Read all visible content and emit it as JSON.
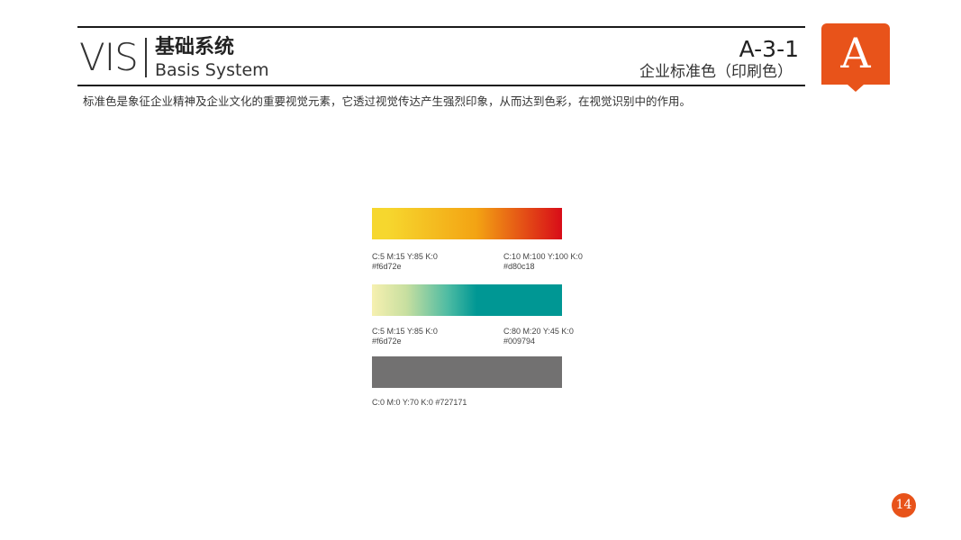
{
  "header": {
    "logo": "VIS",
    "title_cn": "基础系统",
    "title_en": "Basis System",
    "code": "A-3-1",
    "subtitle": "企业标准色（印刷色）"
  },
  "tab": {
    "letter": "A",
    "color": "#e8531a"
  },
  "description": "标准色是象征企业精神及企业文化的重要视觉元素，它透过视觉传达产生强烈印象，从而达到色彩，在视觉识别中的作用。",
  "swatches": [
    {
      "gradient_colors": [
        "#f6d72e",
        "#d80c18"
      ],
      "left_cmyk": "C:5  M:15  Y:85  K:0",
      "left_hex": "#f6d72e",
      "right_cmyk": "C:10  M:100  Y:100  K:0",
      "right_hex": "#d80c18"
    },
    {
      "gradient_colors": [
        "#f6f0b0",
        "#009794"
      ],
      "left_cmyk": "C:5  M:15  Y:85  K:0",
      "left_hex": "#f6d72e",
      "right_cmyk": "C:80  M:20  Y:45  K:0",
      "right_hex": "#009794"
    },
    {
      "solid_color": "#727171",
      "label": "C:0  M:0  Y:70  K:0  #727171"
    }
  ],
  "page_number": "14"
}
